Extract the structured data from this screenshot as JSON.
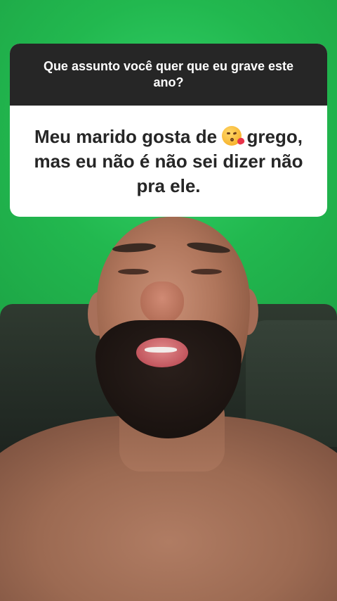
{
  "question_sticker": {
    "question": "Que assunto você quer que eu grave este ano?",
    "answer_before_emoji": "Meu marido gosta de ",
    "emoji": "kissing-face-with-heart-emoji",
    "answer_after_emoji": " grego, mas eu não é não sei dizer não pra ele."
  },
  "colors": {
    "background_green": "#27c25a",
    "header_dark": "#262626",
    "card_white": "#ffffff",
    "text_dark": "#262626"
  }
}
